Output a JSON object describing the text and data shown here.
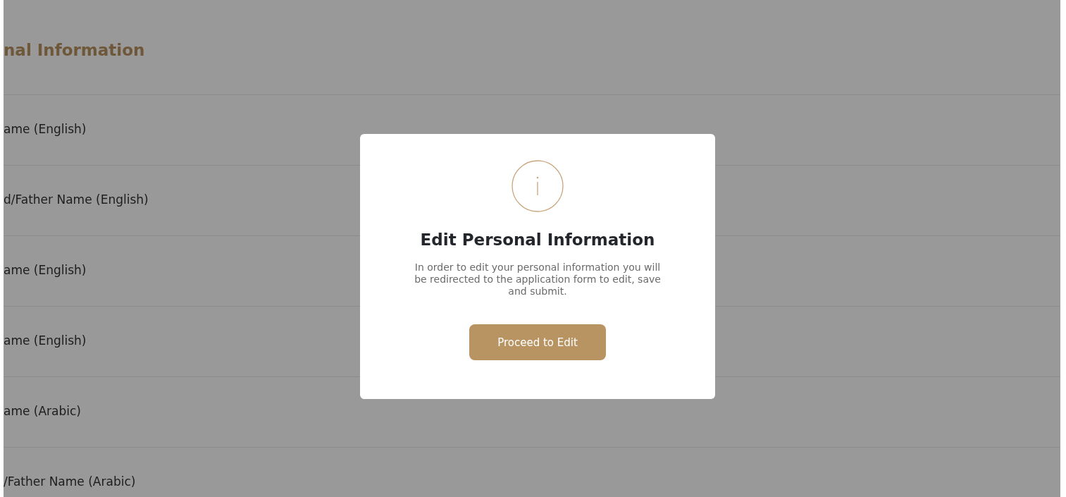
{
  "page": {
    "heading": "nal Information",
    "rows": [
      {
        "label": "ame (English)"
      },
      {
        "label": "d/Father Name (English)"
      },
      {
        "label": "ame (English)"
      },
      {
        "label": "ame (English)"
      },
      {
        "label": "ame (Arabic)"
      },
      {
        "label": "/Father Name (Arabic)"
      }
    ]
  },
  "dialog": {
    "title": "Edit Personal Information",
    "message": "In order to edit your personal information you will be redirected to the application form to edit, save and submit.",
    "button": "Proceed to Edit"
  }
}
